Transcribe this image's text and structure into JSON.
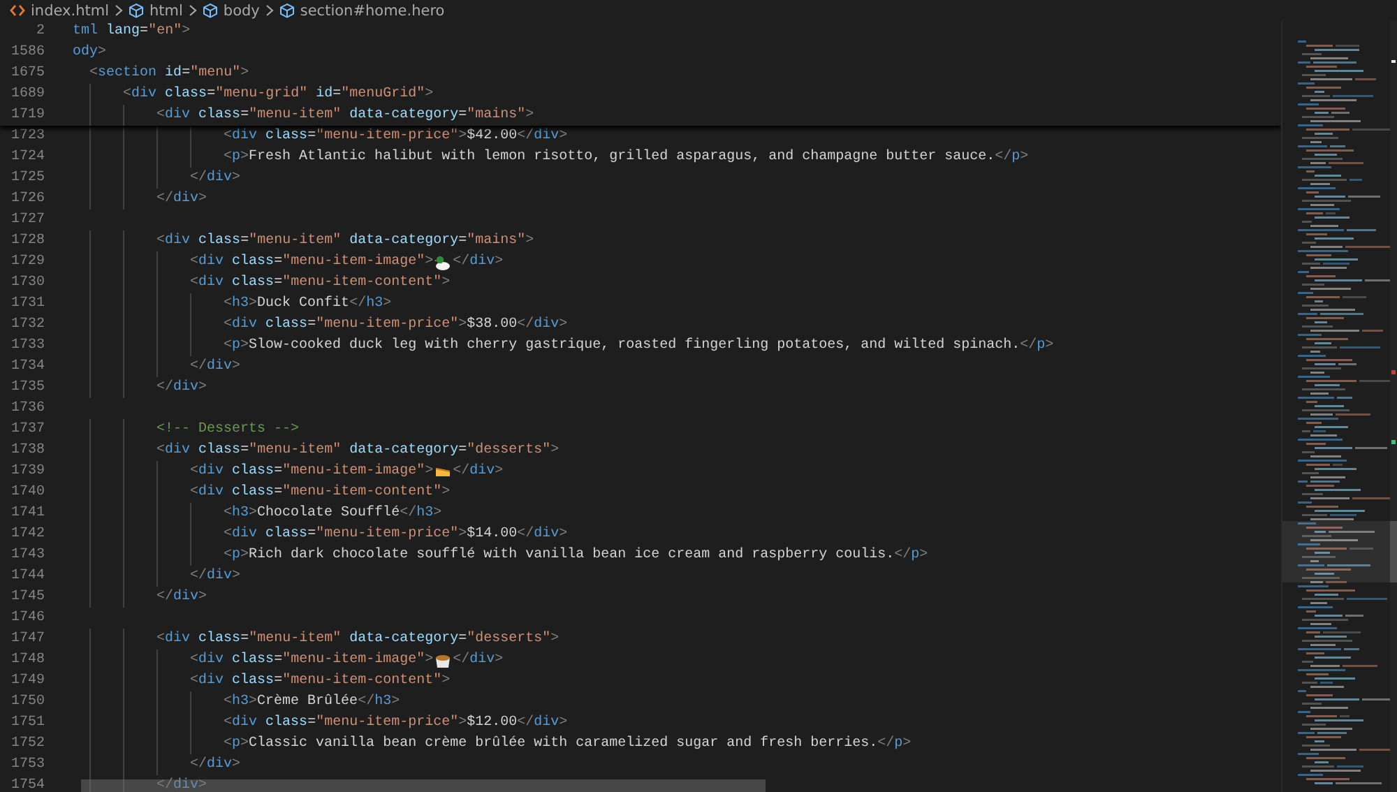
{
  "breadcrumbs": [
    {
      "kind": "file",
      "label": "index.html"
    },
    {
      "kind": "element",
      "label": "html"
    },
    {
      "kind": "element",
      "label": "body"
    },
    {
      "kind": "element",
      "label": "section#home.hero"
    }
  ],
  "sticky_lines": [
    {
      "number": "2",
      "cut_tag": true,
      "segments": [
        {
          "kind": "code",
          "text": "tml lang=\"en\">"
        }
      ]
    },
    {
      "number": "1586",
      "cut_tag": true,
      "segments": [
        {
          "kind": "code",
          "text": "ody>"
        }
      ]
    },
    {
      "number": "1675",
      "segments": [
        {
          "kind": "code",
          "text": "  <section id=\"menu\">"
        }
      ]
    },
    {
      "number": "1689",
      "segments": [
        {
          "kind": "code",
          "text": "      <div class=\"menu-grid\" id=\"menuGrid\">"
        }
      ]
    },
    {
      "number": "1719",
      "segments": [
        {
          "kind": "code",
          "text": "          <div class=\"menu-item\" data-category=\"mains\">"
        }
      ]
    }
  ],
  "lines": [
    {
      "number": "1723",
      "segments": [
        {
          "kind": "code",
          "text": "                  <div class=\"menu-item-price\">$42.00</div>"
        }
      ]
    },
    {
      "number": "1724",
      "segments": [
        {
          "kind": "code",
          "text": "                  <p>Fresh Atlantic halibut with lemon risotto, grilled asparagus, and champagne butter sauce.</p>"
        }
      ]
    },
    {
      "number": "1725",
      "segments": [
        {
          "kind": "code",
          "text": "              </div>"
        }
      ]
    },
    {
      "number": "1726",
      "segments": [
        {
          "kind": "code",
          "text": "          </div>"
        }
      ]
    },
    {
      "number": "1727"
    },
    {
      "number": "1728",
      "segments": [
        {
          "kind": "code",
          "text": "          <div class=\"menu-item\" data-category=\"mains\">"
        }
      ]
    },
    {
      "number": "1729",
      "segments": [
        {
          "kind": "code",
          "text": "              <div class=\"menu-item-image\">"
        },
        {
          "kind": "icon"
        },
        {
          "kind": "code",
          "text": "</div>"
        }
      ]
    },
    {
      "number": "1730",
      "segments": [
        {
          "kind": "code",
          "text": "              <div class=\"menu-item-content\">"
        }
      ]
    },
    {
      "number": "1731",
      "segments": [
        {
          "kind": "code",
          "text": "                  <h3>Duck Confit</h3>"
        }
      ]
    },
    {
      "number": "1732",
      "segments": [
        {
          "kind": "code",
          "text": "                  <div class=\"menu-item-price\">$38.00</div>"
        }
      ]
    },
    {
      "number": "1733",
      "segments": [
        {
          "kind": "code",
          "text": "                  <p>Slow-cooked duck leg with cherry gastrique, roasted fingerling potatoes, and wilted spinach.</p>"
        }
      ]
    },
    {
      "number": "1734",
      "segments": [
        {
          "kind": "code",
          "text": "              </div>"
        }
      ]
    },
    {
      "number": "1735",
      "segments": [
        {
          "kind": "code",
          "text": "          </div>"
        }
      ]
    },
    {
      "number": "1736"
    },
    {
      "number": "1737",
      "segments": [
        {
          "kind": "code",
          "text": "          <!-- Desserts -->"
        }
      ]
    },
    {
      "number": "1738",
      "segments": [
        {
          "kind": "code",
          "text": "          <div class=\"menu-item\" data-category=\"desserts\">"
        }
      ]
    },
    {
      "number": "1739",
      "segments": [
        {
          "kind": "code",
          "text": "              <div class=\"menu-item-image\">"
        },
        {
          "kind": "icon"
        },
        {
          "kind": "code",
          "text": "</div>"
        }
      ]
    },
    {
      "number": "1740",
      "segments": [
        {
          "kind": "code",
          "text": "              <div class=\"menu-item-content\">"
        }
      ]
    },
    {
      "number": "1741",
      "segments": [
        {
          "kind": "code",
          "text": "                  <h3>Chocolate Soufflé</h3>"
        }
      ]
    },
    {
      "number": "1742",
      "segments": [
        {
          "kind": "code",
          "text": "                  <div class=\"menu-item-price\">$14.00</div>"
        }
      ]
    },
    {
      "number": "1743",
      "segments": [
        {
          "kind": "code",
          "text": "                  <p>Rich dark chocolate soufflé with vanilla bean ice cream and raspberry coulis.</p>"
        }
      ]
    },
    {
      "number": "1744",
      "segments": [
        {
          "kind": "code",
          "text": "              </div>"
        }
      ]
    },
    {
      "number": "1745",
      "segments": [
        {
          "kind": "code",
          "text": "          </div>"
        }
      ]
    },
    {
      "number": "1746"
    },
    {
      "number": "1747",
      "segments": [
        {
          "kind": "code",
          "text": "          <div class=\"menu-item\" data-category=\"desserts\">"
        }
      ]
    },
    {
      "number": "1748",
      "segments": [
        {
          "kind": "code",
          "text": "              <div class=\"menu-item-image\">"
        },
        {
          "kind": "icon"
        },
        {
          "kind": "code",
          "text": "</div>"
        }
      ]
    },
    {
      "number": "1749",
      "segments": [
        {
          "kind": "code",
          "text": "              <div class=\"menu-item-content\">"
        }
      ]
    },
    {
      "number": "1750",
      "segments": [
        {
          "kind": "code",
          "text": "                  <h3>Crème Brûlée</h3>"
        }
      ]
    },
    {
      "number": "1751",
      "segments": [
        {
          "kind": "code",
          "text": "                  <div class=\"menu-item-price\">$12.00</div>"
        }
      ]
    },
    {
      "number": "1752",
      "segments": [
        {
          "kind": "code",
          "text": "                  <p>Classic vanilla bean crème brûlée with caramelized sugar and fresh berries.</p>"
        }
      ]
    },
    {
      "number": "1753",
      "segments": [
        {
          "kind": "code",
          "text": "              </div>"
        }
      ]
    },
    {
      "number": "1754",
      "segments": [
        {
          "kind": "code",
          "text": "          </div>"
        }
      ]
    }
  ]
}
